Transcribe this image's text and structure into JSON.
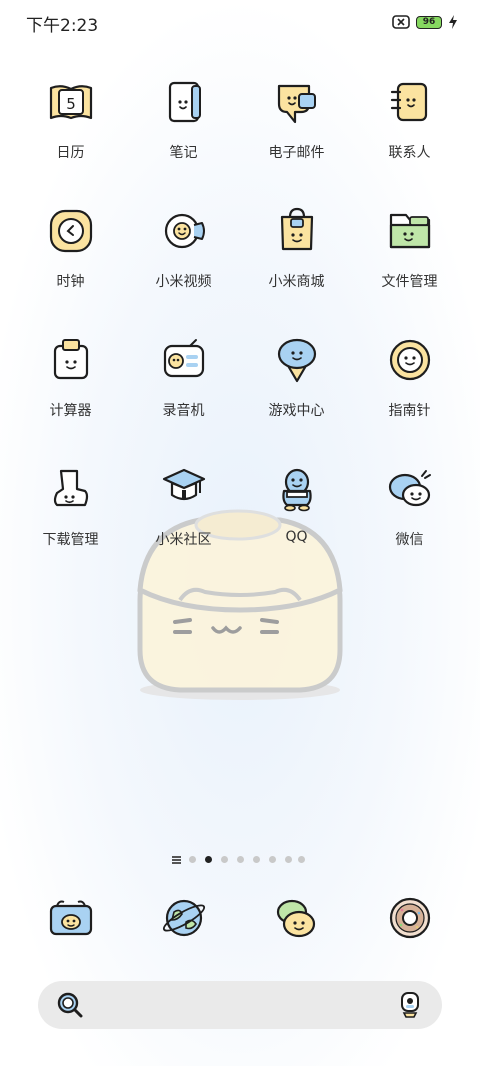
{
  "status_bar": {
    "time": "下午2:23",
    "battery_level": "96",
    "icons": [
      "signal-off-icon",
      "battery-icon",
      "charging-icon"
    ]
  },
  "home_screen": {
    "apps": [
      {
        "label": "日历",
        "icon": "calendar-icon"
      },
      {
        "label": "笔记",
        "icon": "notes-icon"
      },
      {
        "label": "电子邮件",
        "icon": "email-icon"
      },
      {
        "label": "联系人",
        "icon": "contacts-icon"
      },
      {
        "label": "时钟",
        "icon": "clock-icon"
      },
      {
        "label": "小米视频",
        "icon": "video-icon"
      },
      {
        "label": "小米商城",
        "icon": "store-icon"
      },
      {
        "label": "文件管理",
        "icon": "folder-icon"
      },
      {
        "label": "计算器",
        "icon": "calculator-icon"
      },
      {
        "label": "录音机",
        "icon": "recorder-icon"
      },
      {
        "label": "游戏中心",
        "icon": "game-center-icon"
      },
      {
        "label": "指南针",
        "icon": "compass-icon"
      },
      {
        "label": "下载管理",
        "icon": "download-icon"
      },
      {
        "label": "小米社区",
        "icon": "community-icon"
      },
      {
        "label": "QQ",
        "icon": "qq-icon"
      },
      {
        "label": "微信",
        "icon": "wechat-icon"
      }
    ],
    "calendar_day": "5"
  },
  "page_indicator": {
    "page_count": 7,
    "active_index": 1
  },
  "dock": {
    "apps": [
      {
        "icon": "phone-icon"
      },
      {
        "icon": "browser-icon"
      },
      {
        "icon": "messages-icon"
      },
      {
        "icon": "camera-icon"
      }
    ]
  },
  "search_bar": {
    "icons": [
      "search-icon",
      "assistant-icon"
    ]
  },
  "theme": {
    "icon_yellow": "#fbe3a0",
    "icon_blue": "#a9d2f2",
    "icon_green": "#bfe6a8",
    "outline": "#1e1e1e",
    "battery_green": "#86d860",
    "search_bg": "#eaeaea"
  }
}
